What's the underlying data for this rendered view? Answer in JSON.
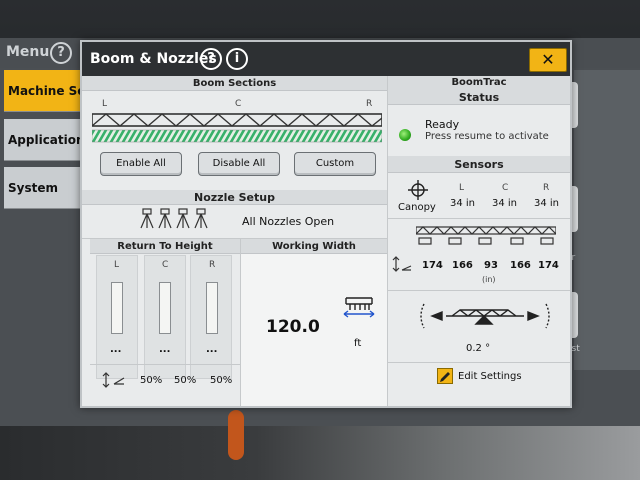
{
  "background": {
    "menu_label": "Menu",
    "help_glyph": "?",
    "nav_items": [
      "Machine Setti",
      "Applications",
      "System"
    ],
    "right_edge_labels": [
      "or",
      "ast"
    ]
  },
  "dialog": {
    "title": "Boom & Nozzles",
    "help_glyph": "?",
    "info_glyph": "i",
    "close_glyph": "✕"
  },
  "boom_sections": {
    "header": "Boom Sections",
    "left_label": "L",
    "center_label": "C",
    "right_label": "R",
    "buttons": {
      "enable_all": "Enable All",
      "disable_all": "Disable All",
      "custom": "Custom"
    }
  },
  "nozzle_setup": {
    "header": "Nozzle Setup",
    "status": "All Nozzles Open"
  },
  "return_to_height": {
    "header": "Return To Height",
    "columns": [
      {
        "label": "L",
        "value": "..."
      },
      {
        "label": "C",
        "value": "..."
      },
      {
        "label": "R",
        "value": "..."
      }
    ],
    "percentages": [
      "50%",
      "50%",
      "50%"
    ]
  },
  "working_width": {
    "header": "Working Width",
    "value": "120.0",
    "unit": "ft"
  },
  "boomtrac": {
    "header": "BoomTrac",
    "status_header": "Status",
    "status": "Ready",
    "status_detail": "Press resume to activate",
    "status_color": "#2eaa1e"
  },
  "sensors": {
    "header": "Sensors",
    "mode_label": "Canopy",
    "readings": [
      {
        "label": "L",
        "value": "34 in"
      },
      {
        "label": "C",
        "value": "34 in"
      },
      {
        "label": "R",
        "value": "34 in"
      }
    ],
    "heights": [
      "174",
      "166",
      "93",
      "166",
      "174"
    ],
    "heights_unit": "(in)",
    "tilt": "0.2 °",
    "edit_settings": "Edit Settings"
  },
  "colors": {
    "accent": "#f2b415",
    "title_bar": "#2d3033",
    "panel": "#e9ebec"
  }
}
